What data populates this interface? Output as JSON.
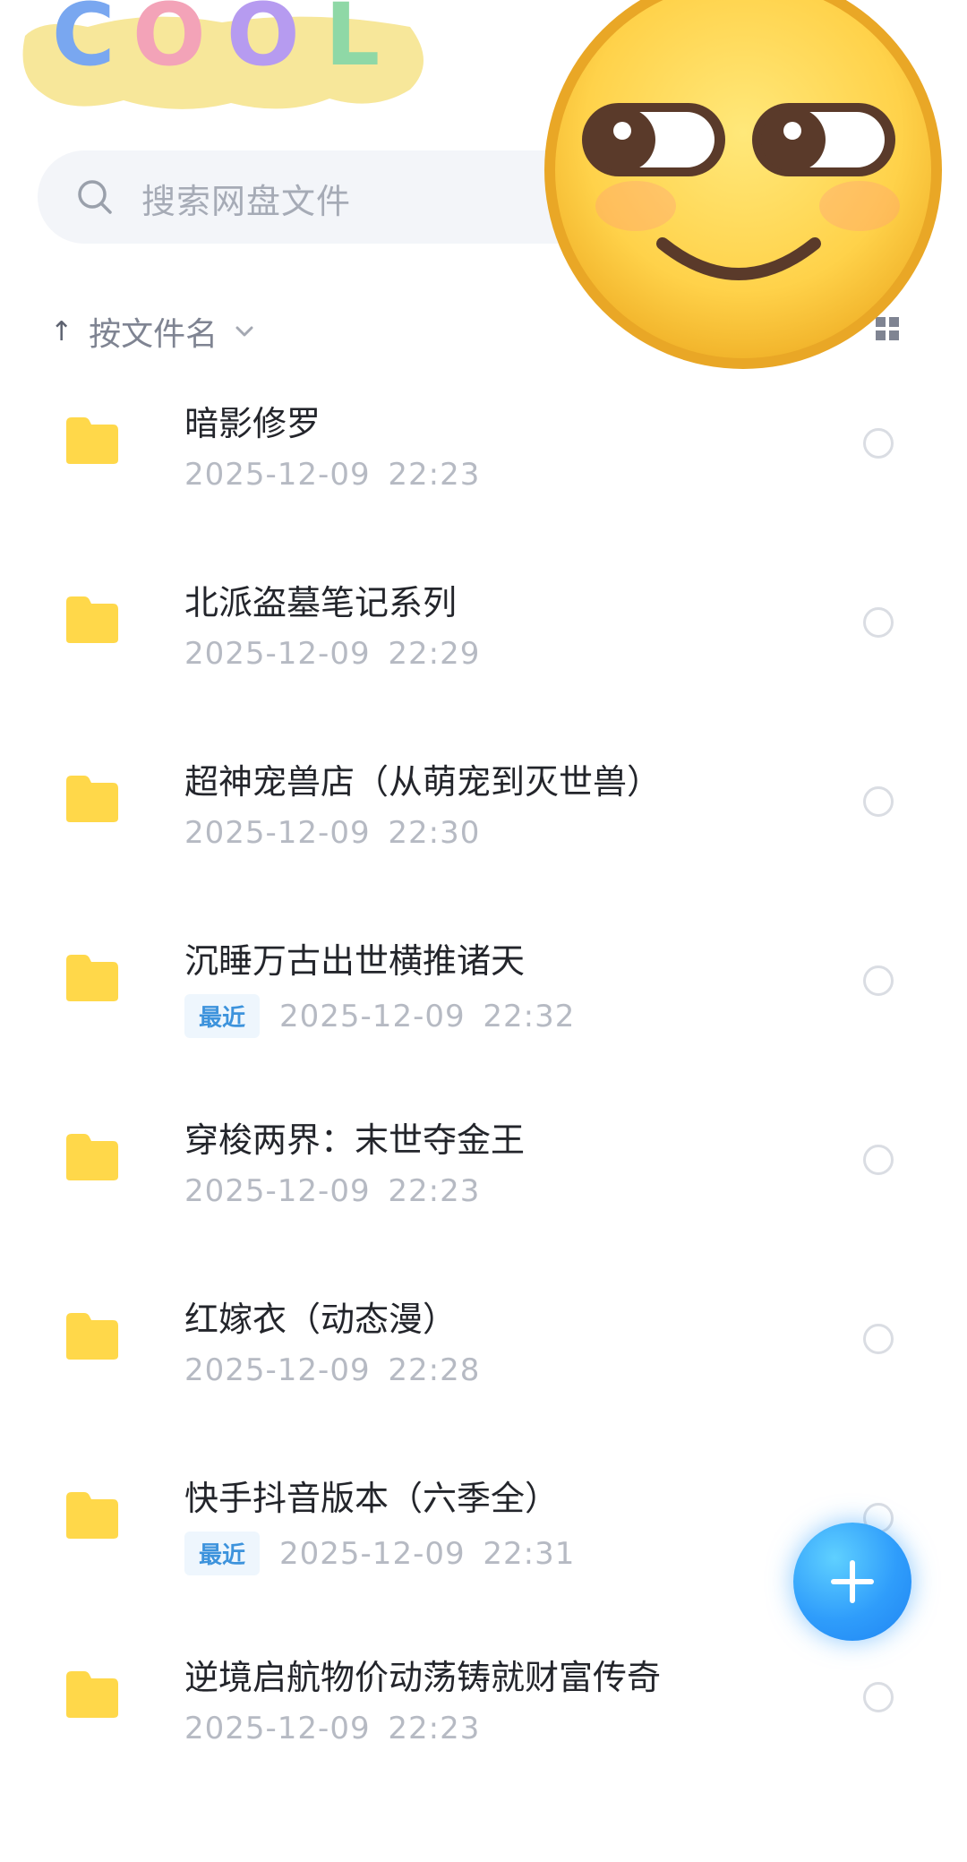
{
  "sticker": {
    "text": "COOL"
  },
  "search": {
    "placeholder": "搜索网盘文件"
  },
  "sort": {
    "label": "按文件名"
  },
  "files": [
    {
      "name": "暗影修罗",
      "time": "2025-12-09  22:23",
      "badge": ""
    },
    {
      "name": "北派盗墓笔记系列",
      "time": "2025-12-09  22:29",
      "badge": ""
    },
    {
      "name": "超神宠兽店（从萌宠到灭世兽）",
      "time": "2025-12-09  22:30",
      "badge": ""
    },
    {
      "name": "沉睡万古出世横推诸天",
      "time": "2025-12-09  22:32",
      "badge": "最近"
    },
    {
      "name": "穿梭两界：末世夺金王",
      "time": "2025-12-09  22:23",
      "badge": ""
    },
    {
      "name": "红嫁衣（动态漫）",
      "time": "2025-12-09  22:28",
      "badge": ""
    },
    {
      "name": "快手抖音版本（六季全）",
      "time": "2025-12-09  22:31",
      "badge": "最近"
    },
    {
      "name": "逆境启航物价动荡铸就财富传奇",
      "time": "2025-12-09  22:23",
      "badge": ""
    }
  ],
  "icons": {
    "search": "search-icon",
    "sort_arrow": "arrow-up-icon",
    "chevron": "chevron-down-icon",
    "view": "grid-view-icon",
    "folder": "folder-icon",
    "add": "plus-icon"
  },
  "colors": {
    "folder": "#FFD84A",
    "accent": "#2F9DFB",
    "badge_text": "#3D93DC"
  }
}
